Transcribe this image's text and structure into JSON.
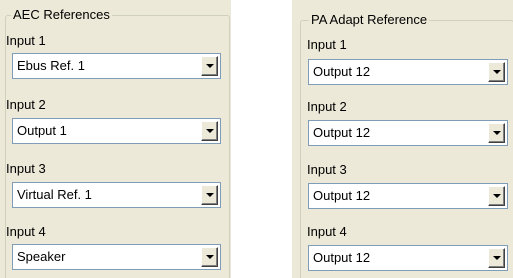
{
  "aec": {
    "title": "AEC References",
    "inputs": [
      {
        "label": "Input 1",
        "value": "Ebus Ref. 1"
      },
      {
        "label": "Input 2",
        "value": "Output 1"
      },
      {
        "label": "Input 3",
        "value": "Virtual Ref. 1"
      },
      {
        "label": "Input 4",
        "value": "Speaker"
      }
    ]
  },
  "pa": {
    "title": "PA Adapt Reference",
    "inputs": [
      {
        "label": "Input 1",
        "value": "Output 12"
      },
      {
        "label": "Input 2",
        "value": "Output 12"
      },
      {
        "label": "Input 3",
        "value": "Output 12"
      },
      {
        "label": "Input 4",
        "value": "Output 12"
      }
    ]
  },
  "icons": {
    "dropdown": "chevron-down-icon"
  },
  "colors": {
    "panel_background": "#ece9d8",
    "field_border": "#7f9db9",
    "group_border": "#d0d0bf"
  }
}
